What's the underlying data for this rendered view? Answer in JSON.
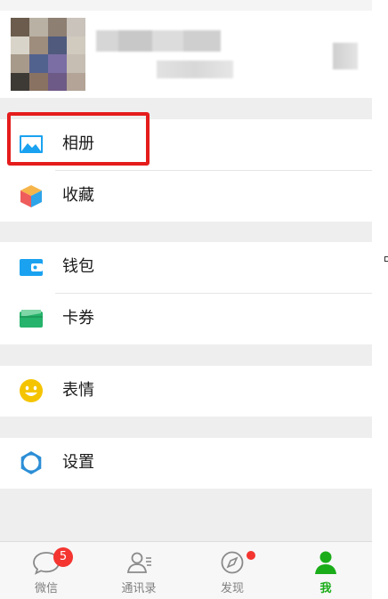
{
  "menu": {
    "groups": [
      {
        "items": [
          {
            "label": "相册",
            "icon": "album-icon"
          },
          {
            "label": "收藏",
            "icon": "favorites-icon"
          }
        ]
      },
      {
        "items": [
          {
            "label": "钱包",
            "icon": "wallet-icon"
          },
          {
            "label": "卡券",
            "icon": "card-coupon-icon"
          }
        ]
      },
      {
        "items": [
          {
            "label": "表情",
            "icon": "sticker-smiley-icon"
          }
        ]
      },
      {
        "items": [
          {
            "label": "设置",
            "icon": "settings-gear-icon"
          }
        ]
      }
    ]
  },
  "tabbar": {
    "tabs": [
      {
        "label": "微信",
        "icon": "chat-bubble-icon",
        "badge": "5"
      },
      {
        "label": "通讯录",
        "icon": "contacts-icon"
      },
      {
        "label": "发现",
        "icon": "discover-compass-icon"
      },
      {
        "label": "我",
        "icon": "me-person-icon"
      }
    ]
  },
  "colors": {
    "highlight": "#e51c1c",
    "active_tab": "#1aad19",
    "badge": "#f43530",
    "icon_blue": "#1aa2f0",
    "icon_yellow": "#f5c400"
  }
}
